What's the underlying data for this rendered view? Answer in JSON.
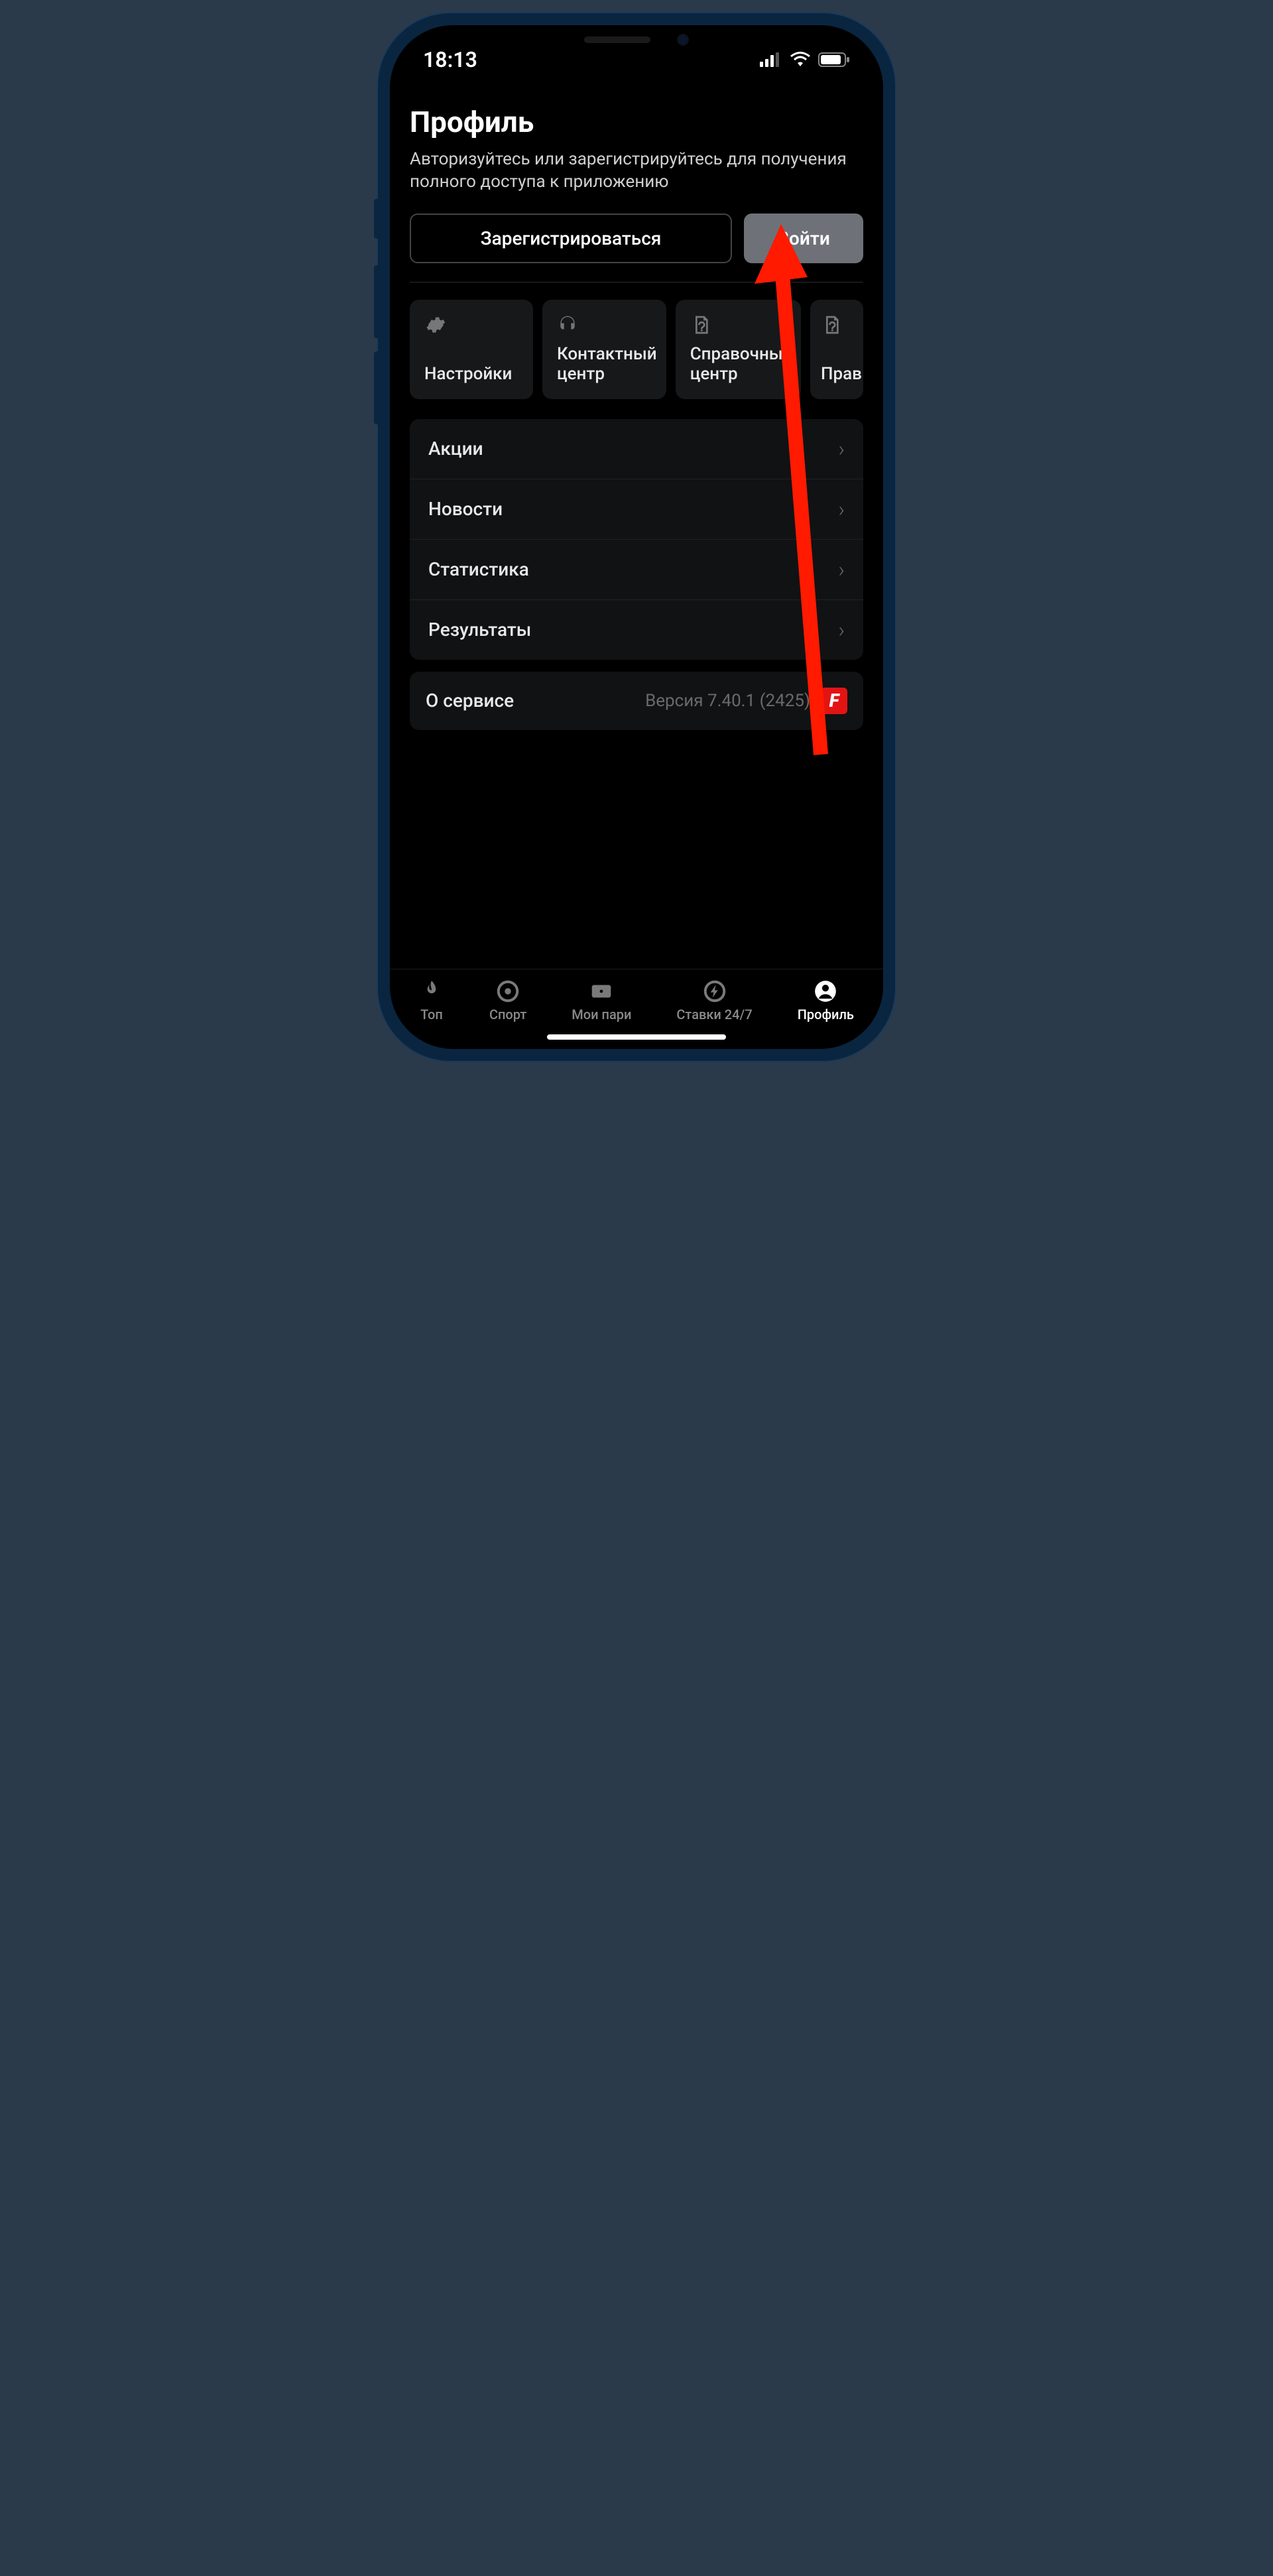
{
  "statusBar": {
    "time": "18:13"
  },
  "header": {
    "title": "Профиль",
    "subtitle": "Авторизуйтесь или зарегистрируйтесь для получения полного доступа к приложению"
  },
  "auth": {
    "register": "Зарегистрироваться",
    "login": "Войти"
  },
  "tiles": [
    {
      "label": "Настройки",
      "icon": "gear-icon"
    },
    {
      "label": "Контактный центр",
      "icon": "headset-icon"
    },
    {
      "label": "Справочный центр",
      "icon": "help-file-icon"
    },
    {
      "label": "Прав",
      "icon": "help-file-icon"
    }
  ],
  "menu": [
    {
      "label": "Акции"
    },
    {
      "label": "Новости"
    },
    {
      "label": "Статистика"
    },
    {
      "label": "Результаты"
    }
  ],
  "about": {
    "label": "О сервисе",
    "version": "Версия 7.40.1 (2425)"
  },
  "nav": [
    {
      "label": "Топ",
      "icon": "flame-icon",
      "active": false
    },
    {
      "label": "Спорт",
      "icon": "target-icon",
      "active": false
    },
    {
      "label": "Мои пари",
      "icon": "ticket-icon",
      "active": false
    },
    {
      "label": "Ставки 24/7",
      "icon": "bolt-circle-icon",
      "active": false
    },
    {
      "label": "Профиль",
      "icon": "person-circle-icon",
      "active": true
    }
  ]
}
